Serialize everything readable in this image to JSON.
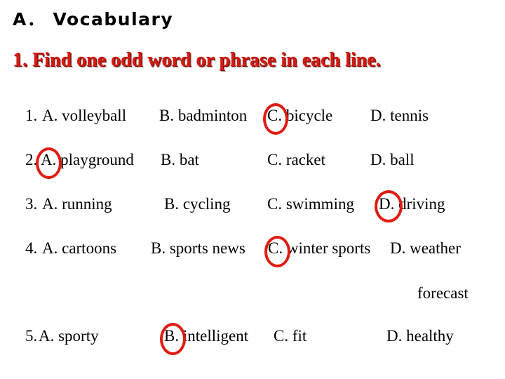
{
  "document": {
    "section_heading": "A． Vocabulary",
    "task_heading": "1. Find one odd word or phrase in each line.",
    "accent_color": "#d61a12",
    "mark_color": "#e01b0f",
    "text_color": "#000000",
    "background_color": "#ffffff"
  },
  "questions": [
    {
      "number": "1.",
      "options": [
        {
          "label": "A. volleyball",
          "circled": false
        },
        {
          "label": "B. badminton",
          "circled": false
        },
        {
          "label": "C. bicycle",
          "circled": true
        },
        {
          "label": "D. tennis",
          "circled": false
        }
      ],
      "answer": "C"
    },
    {
      "number": "2.",
      "options": [
        {
          "label": "A. playground",
          "circled": true
        },
        {
          "label": "B. bat",
          "circled": false
        },
        {
          "label": "C. racket",
          "circled": false
        },
        {
          "label": "D. ball",
          "circled": false
        }
      ],
      "answer": "A"
    },
    {
      "number": "3.",
      "options": [
        {
          "label": "A. running",
          "circled": false
        },
        {
          "label": "B. cycling",
          "circled": false
        },
        {
          "label": "C. swimming",
          "circled": false
        },
        {
          "label": "D. driving",
          "circled": true
        }
      ],
      "answer": "D"
    },
    {
      "number": "4.",
      "options": [
        {
          "label": "A. cartoons",
          "circled": false
        },
        {
          "label": "B. sports news",
          "circled": false
        },
        {
          "label": "C. winter sports",
          "circled": true
        },
        {
          "label": "D. weather",
          "circled": false
        }
      ],
      "answer": "C",
      "wrapped_text": "forecast"
    },
    {
      "number": "5.",
      "options": [
        {
          "label": "A. sporty",
          "circled": false
        },
        {
          "label": "B. intelligent",
          "circled": true
        },
        {
          "label": "C. fit",
          "circled": false
        },
        {
          "label": "D. healthy",
          "circled": false
        }
      ],
      "answer": "B"
    }
  ],
  "rendered_lines": {
    "q1": {
      "num": "1.",
      "a": "A. volleyball",
      "b": "B. badminton",
      "c": "C. bicycle",
      "d": "D. tennis"
    },
    "q2": {
      "num": "2.",
      "a": "A. playground",
      "b": "B. bat",
      "c": "C. racket",
      "d": "D. ball"
    },
    "q3": {
      "num": "3.",
      "a": "A. running",
      "b": "B. cycling",
      "c": "C. swimming",
      "d": "D. driving"
    },
    "q4": {
      "num": "4.",
      "a": "A. cartoons",
      "b": "B. sports news",
      "c": "C. winter sports",
      "d": "D. weather",
      "wrap": "forecast"
    },
    "q5": {
      "num": "5.",
      "a": "A. sporty",
      "b": "B. intelligent",
      "c": "C. fit",
      "d": "D. healthy"
    }
  }
}
